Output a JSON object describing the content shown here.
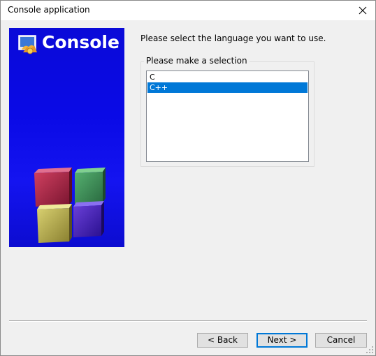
{
  "window": {
    "title": "Console application"
  },
  "banner": {
    "title": "Console"
  },
  "prompt": "Please select the language you want to use.",
  "selection": {
    "group_label": "Please make a selection",
    "options": [
      {
        "label": "C",
        "selected": false
      },
      {
        "label": "C++",
        "selected": true
      }
    ]
  },
  "buttons": {
    "back": "< Back",
    "next": "Next >",
    "cancel": "Cancel"
  },
  "colors": {
    "banner_blue": "#0a0ae6",
    "selection_highlight": "#0078d7",
    "default_button_border": "#0078d7"
  },
  "icons": {
    "close": "close-icon",
    "logo": "codeblocks-logo-icon",
    "cubes": "codeblocks-cubes-graphic",
    "grip": "resize-grip-icon"
  }
}
